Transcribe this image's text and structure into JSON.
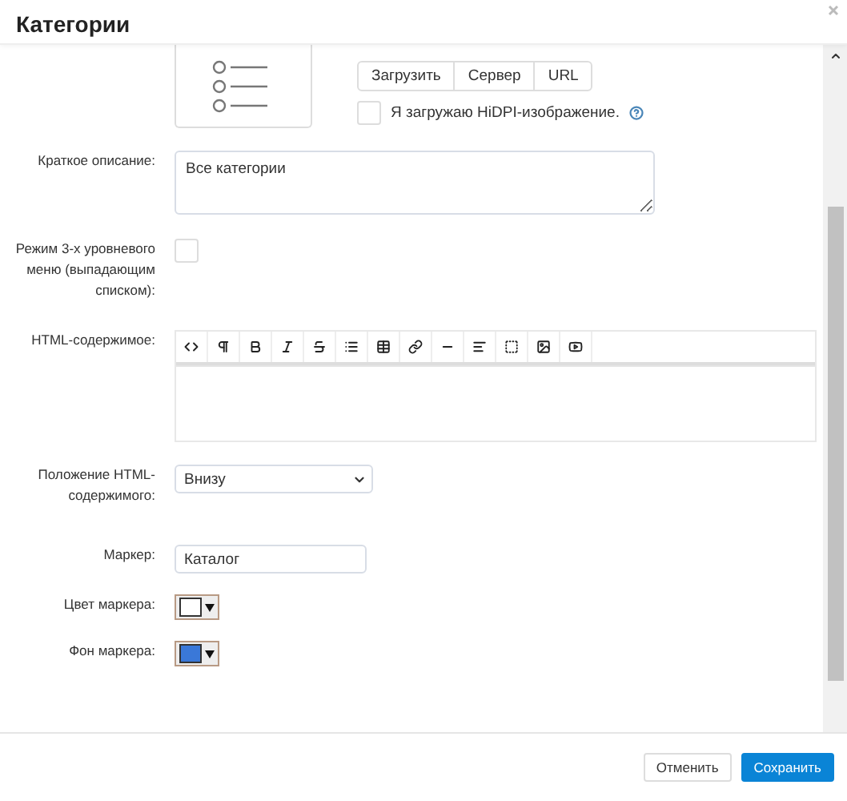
{
  "dialog": {
    "title": "Категории"
  },
  "image_field": {
    "upload_buttons": [
      {
        "label": "Загрузить"
      },
      {
        "label": "Сервер"
      },
      {
        "label": "URL"
      }
    ],
    "hidpi": {
      "label": "Я загружаю HiDPI-изображение.",
      "checked": false
    }
  },
  "fields": [
    {
      "kind": "textarea",
      "label": "Краткое описание:",
      "value": "Все категории"
    },
    {
      "kind": "checkbox",
      "label": "Режим 3-х уровневого меню (выпадающим списком):",
      "checked": false
    },
    {
      "kind": "editor",
      "label": "HTML-содержимое:"
    },
    {
      "kind": "select",
      "label": "Положение HTML-содержимого:",
      "value": "Внизу"
    },
    {
      "kind": "input",
      "label": "Маркер:",
      "value": "Каталог"
    },
    {
      "kind": "color",
      "label": "Цвет маркера:",
      "color": "#ffffff"
    },
    {
      "kind": "color",
      "label": "Фон маркера:",
      "color": "#3a78d8"
    }
  ],
  "buttons": [
    {
      "label": "Отменить",
      "kind": "secondary"
    },
    {
      "label": "Сохранить",
      "kind": "primary"
    }
  ]
}
